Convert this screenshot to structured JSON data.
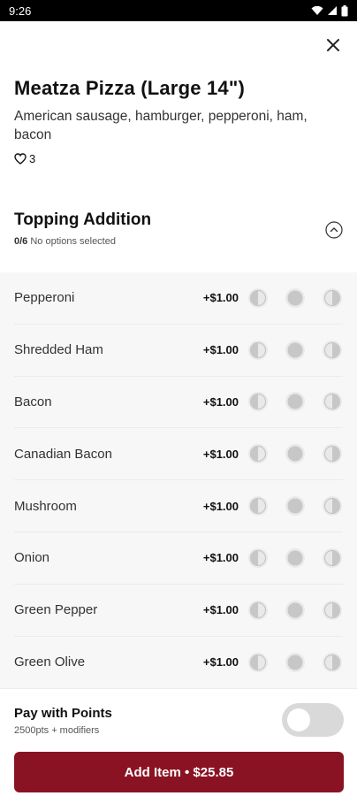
{
  "status_bar": {
    "time": "9:26"
  },
  "item": {
    "title": "Meatza Pizza (Large 14\")",
    "description": "American sausage, hamburger, pepperoni, ham, bacon",
    "likes": "3"
  },
  "section": {
    "title": "Topping Addition",
    "selected_count": "0/6",
    "status_text": "No options selected"
  },
  "options": [
    {
      "name": "Pepperoni",
      "price": "+$1.00"
    },
    {
      "name": "Shredded Ham",
      "price": "+$1.00"
    },
    {
      "name": "Bacon",
      "price": "+$1.00"
    },
    {
      "name": "Canadian Bacon",
      "price": "+$1.00"
    },
    {
      "name": "Mushroom",
      "price": "+$1.00"
    },
    {
      "name": "Onion",
      "price": "+$1.00"
    },
    {
      "name": "Green Pepper",
      "price": "+$1.00"
    },
    {
      "name": "Green Olive",
      "price": "+$1.00"
    }
  ],
  "footer": {
    "points_label": "Pay with Points",
    "points_sub": "2500pts + modifiers",
    "toggle_on": false,
    "add_button_label": "Add Item • $25.85"
  },
  "colors": {
    "brand": "#8a1323",
    "toggle_off": "#d9d9d9",
    "options_bg": "#f7f7f7"
  }
}
